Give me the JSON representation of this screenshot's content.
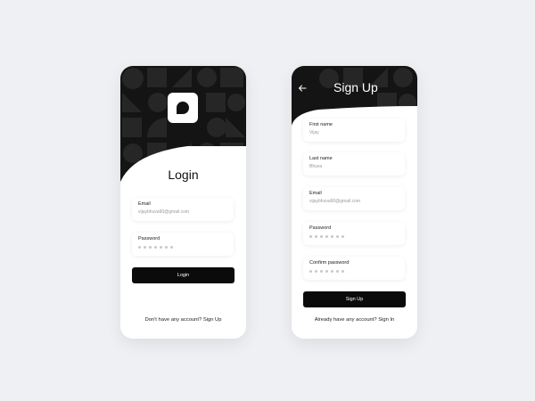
{
  "login": {
    "title": "Login",
    "email": {
      "label": "Email",
      "value": "vijaybhuva90@gmail.com"
    },
    "password": {
      "label": "Password",
      "masked_length": 7
    },
    "button_label": "Login",
    "footer_prompt": "Don't have any account? ",
    "footer_link": "Sign Up"
  },
  "signup": {
    "title": "Sign Up",
    "back_icon": "arrow-left-icon",
    "fields": [
      {
        "label": "First name",
        "value": "Vijay"
      },
      {
        "label": "Last name",
        "value": "Bhuva"
      },
      {
        "label": "Email",
        "value": "vijaybhuva90@gmail.com"
      },
      {
        "label": "Password",
        "masked_length": 7
      },
      {
        "label": "Confirm password",
        "masked_length": 7
      }
    ],
    "button_label": "Sign Up",
    "footer_prompt": "Already have any account? ",
    "footer_link": "Sign In"
  },
  "colors": {
    "background": "#eef0f3",
    "header": "#141414",
    "button": "#0b0b0b",
    "card": "#ffffff"
  },
  "icons": {
    "logo": "chat-bubble-logo-icon",
    "back": "arrow-left-icon"
  }
}
